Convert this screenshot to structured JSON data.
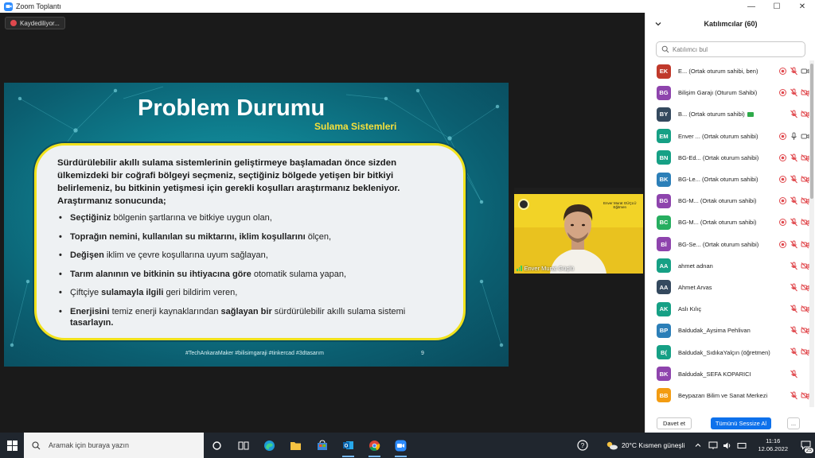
{
  "window": {
    "title": "Zoom Toplantı",
    "controls": {
      "minimize": "—",
      "maximize": "☐",
      "close": "✕"
    }
  },
  "recording": {
    "label": "Kaydediliyor..."
  },
  "slide": {
    "title": "Problem Durumu",
    "subtitle": "Sulama Sistemleri",
    "intro": "Sürdürülebilir akıllı sulama sistemlerinin geliştirmeye başlamadan önce sizden ülkemizdeki bir coğrafi bölgeyi seçmeniz, seçtiğiniz bölgede yetişen bir bitkiyi belirlemeniz, bu bitkinin yetişmesi için gerekli koşulları araştırmanız bekleniyor. Araştırmanız sonucunda;",
    "bullets": [
      {
        "bold": "Seçtiğiniz",
        "rest": " bölgenin şartlarına ve bitkiye uygun olan,"
      },
      {
        "bold": "Toprağın nemini, kullanılan su miktarını, iklim koşullarını",
        "rest": " ölçen,"
      },
      {
        "bold": "Değişen",
        "rest": " iklim ve çevre koşullarına uyum sağlayan,"
      },
      {
        "bold": "Tarım alanının ve bitkinin su ihtiyacına göre",
        "rest": " otomatik sulama yapan,"
      },
      {
        "pre": "Çiftçiye ",
        "bold": "sulamayla ilgili",
        "rest": " geri bildirim veren,"
      },
      {
        "bold": "Enerjisini",
        "rest": " temiz enerji kaynaklarından ",
        "bold2": "sağlayan bir",
        "rest2": " sürdürülebilir akıllı sulama sistemi ",
        "bold3": "tasarlayın."
      }
    ],
    "footer": "#TechAnkaraMaker #bilisimgaraji #tinkercad #3dtasarım",
    "page_number": "9"
  },
  "speaker_video": {
    "name": "Enver Murat Güçlü",
    "card_name": "Enver Murat GÜÇLÜ",
    "card_role": "Eğitmen"
  },
  "participants": {
    "header": "Katılımcılar (60)",
    "search_placeholder": "Katılımcı bul",
    "list": [
      {
        "initials": "EK",
        "color": "#c0392b",
        "name": "E...  (Ortak oturum sahibi, ben)",
        "mic": "muted",
        "cam": "on",
        "rec": true
      },
      {
        "initials": "BG",
        "color": "#8e44ad",
        "name": "Bilişim Garajı (Oturum Sahibi)",
        "mic": "muted",
        "cam": "off",
        "rec": true
      },
      {
        "initials": "BY",
        "color": "#34495e",
        "name": "B...  (Ortak oturum sahibi)",
        "flag": true,
        "mic": "muted",
        "cam": "off",
        "rec": false
      },
      {
        "initials": "EM",
        "color": "#16a085",
        "name": "Enver ...  (Ortak oturum sahibi)",
        "mic": "on",
        "cam": "on",
        "rec": true
      },
      {
        "initials": "BN",
        "color": "#16a085",
        "name": "BG-Ed...  (Ortak oturum sahibi)",
        "mic": "muted",
        "cam": "off",
        "rec": true
      },
      {
        "initials": "BK",
        "color": "#2c7fb8",
        "name": "BG-Le...  (Ortak oturum sahibi)",
        "mic": "muted",
        "cam": "off",
        "rec": true
      },
      {
        "initials": "BG",
        "color": "#8e44ad",
        "name": "BG-M...  (Ortak oturum sahibi)",
        "mic": "muted",
        "cam": "off",
        "rec": true
      },
      {
        "initials": "BC",
        "color": "#27ae60",
        "name": "BG-M...  (Ortak oturum sahibi)",
        "mic": "muted",
        "cam": "off",
        "rec": true
      },
      {
        "initials": "Bİ",
        "color": "#8e44ad",
        "name": "BG-Se...  (Ortak oturum sahibi)",
        "mic": "muted",
        "cam": "off",
        "rec": true
      },
      {
        "initials": "AA",
        "color": "#16a085",
        "name": "ahmet adnan",
        "mic": "muted",
        "cam": "off",
        "rec": false
      },
      {
        "initials": "AA",
        "color": "#34495e",
        "name": "Ahmet Arvas",
        "mic": "muted",
        "cam": "off",
        "rec": false
      },
      {
        "initials": "AK",
        "color": "#16a085",
        "name": "Aslı Kılıç",
        "mic": "muted",
        "cam": "off",
        "rec": false
      },
      {
        "initials": "BP",
        "color": "#2c7fb8",
        "name": "Baldudak_Aysima Pehlivan",
        "mic": "muted",
        "cam": "off",
        "rec": false
      },
      {
        "initials": "B(",
        "color": "#16a085",
        "name": "Baldudak_SıdıkaYalçın (öğretmen)",
        "mic": "muted",
        "cam": "off",
        "rec": false
      },
      {
        "initials": "BK",
        "color": "#8e44ad",
        "name": "Baldudak_SEFA KOPARICI",
        "mic": "muted",
        "cam": "none",
        "rec": false
      },
      {
        "initials": "BB",
        "color": "#f39c12",
        "name": "Beypazarı Bilim ve Sanat Merkezi",
        "mic": "muted",
        "cam": "off",
        "rec": false
      }
    ],
    "footer": {
      "invite": "Davet et",
      "mute_all": "Tümünü Sessize Al",
      "more": "..."
    }
  },
  "taskbar": {
    "search_placeholder": "Aramak için buraya yazın",
    "weather": "20°C  Kısmen güneşli",
    "time": "11:16",
    "date": "12.06.2022",
    "notifications": "25"
  },
  "colors": {
    "zoom_blue": "#0e71eb",
    "mute_red": "#e0484d",
    "slide_yellow": "#f1e21c",
    "slide_teal": "#0f8090"
  }
}
